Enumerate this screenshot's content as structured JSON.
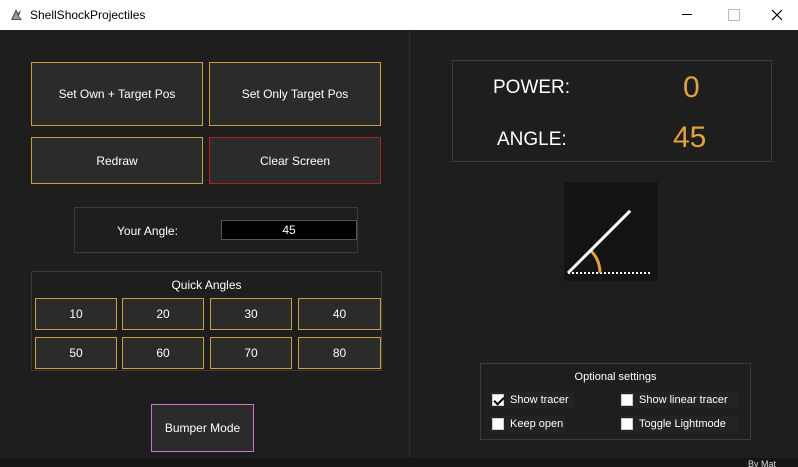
{
  "window": {
    "title": "ShellShockProjectiles"
  },
  "controls": {
    "set_own_target": "Set Own + Target Pos",
    "set_only_target": "Set Only Target Pos",
    "redraw": "Redraw",
    "clear_screen": "Clear Screen"
  },
  "angle_input": {
    "label": "Your Angle:",
    "value": "45"
  },
  "quick_angles": {
    "title": "Quick Angles",
    "values": [
      "10",
      "20",
      "30",
      "40",
      "50",
      "60",
      "70",
      "80"
    ]
  },
  "bumper_mode": "Bumper Mode",
  "stats": {
    "power_label": "POWER:",
    "power_value": "0",
    "angle_label": "ANGLE:",
    "angle_value": "45"
  },
  "angle_visual": {
    "angle_degrees": 45
  },
  "optional_settings": {
    "title": "Optional  settings",
    "show_tracer": {
      "label": "Show tracer",
      "checked": true
    },
    "show_linear_tracer": {
      "label": "Show linear tracer",
      "checked": false
    },
    "keep_open": {
      "label": "Keep open",
      "checked": false
    },
    "toggle_lightmode": {
      "label": "Toggle Lightmode",
      "checked": false
    }
  },
  "footer": {
    "credit": "By Mat"
  },
  "colors": {
    "accent_gold": "#e2a23f",
    "button_border_gold": "#c9a040",
    "button_border_red": "#b02020",
    "button_border_pink": "#d070d0",
    "background": "#1e1e1e"
  }
}
